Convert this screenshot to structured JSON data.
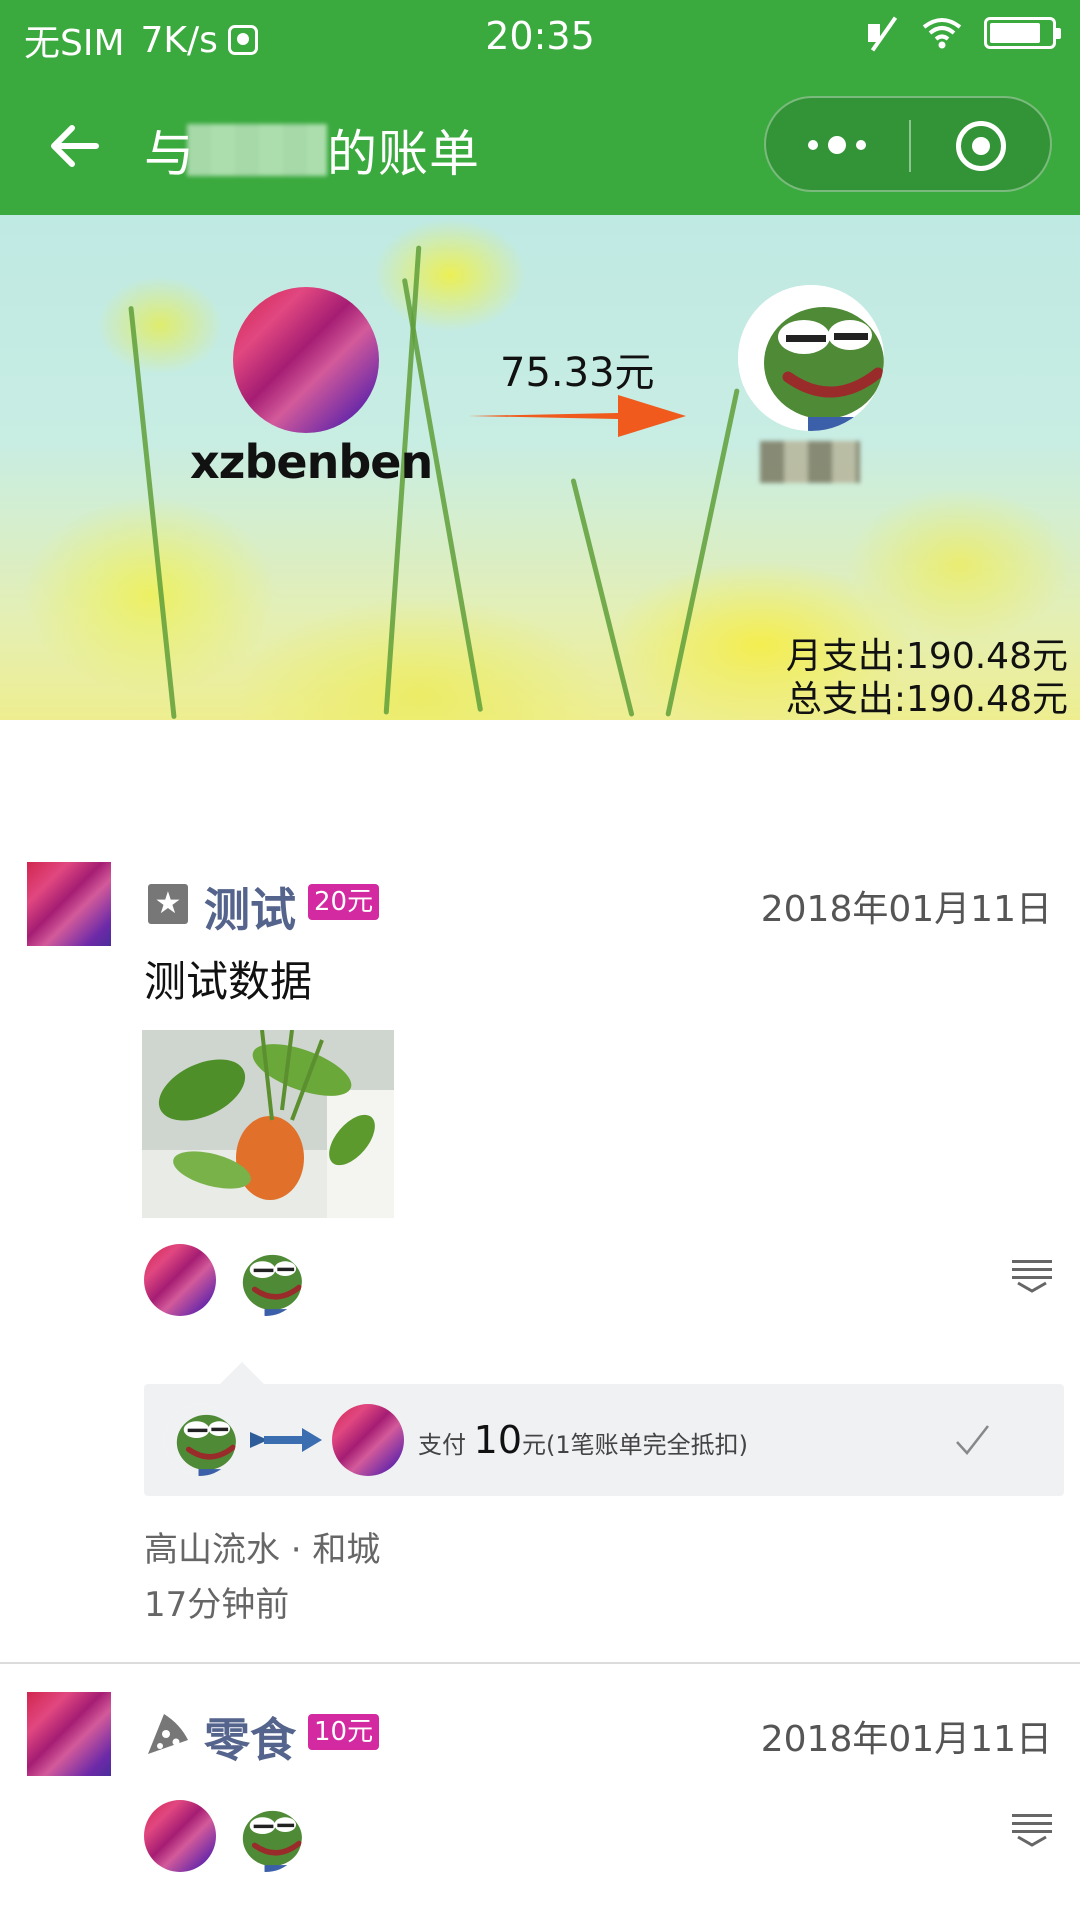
{
  "status_bar": {
    "carrier": "无SIM",
    "speed": "7K/s",
    "time": "20:35"
  },
  "nav": {
    "title_prefix": "与",
    "title_suffix": "的账单"
  },
  "banner": {
    "payer_name": "xzbenben",
    "transfer_amount": "75.33元",
    "month_spend": "月支出:190.48元",
    "total_spend": "总支出:190.48元"
  },
  "posts": [
    {
      "category": "测试",
      "amount_badge": "20元",
      "date": "2018年01月11日",
      "description": "测试数据",
      "settlement": {
        "prefix": "支付",
        "amount": "10",
        "suffix": "元(1笔账单完全抵扣)"
      },
      "location": "高山流水 · 和城",
      "time_ago": "17分钟前"
    },
    {
      "category": "零食",
      "amount_badge": "10元",
      "date": "2018年01月11日"
    }
  ],
  "colors": {
    "nav_green": "#3aa93e",
    "category_text": "#55648c",
    "badge_magenta": "#d42aa1",
    "arrow_orange": "#f05a1c"
  }
}
